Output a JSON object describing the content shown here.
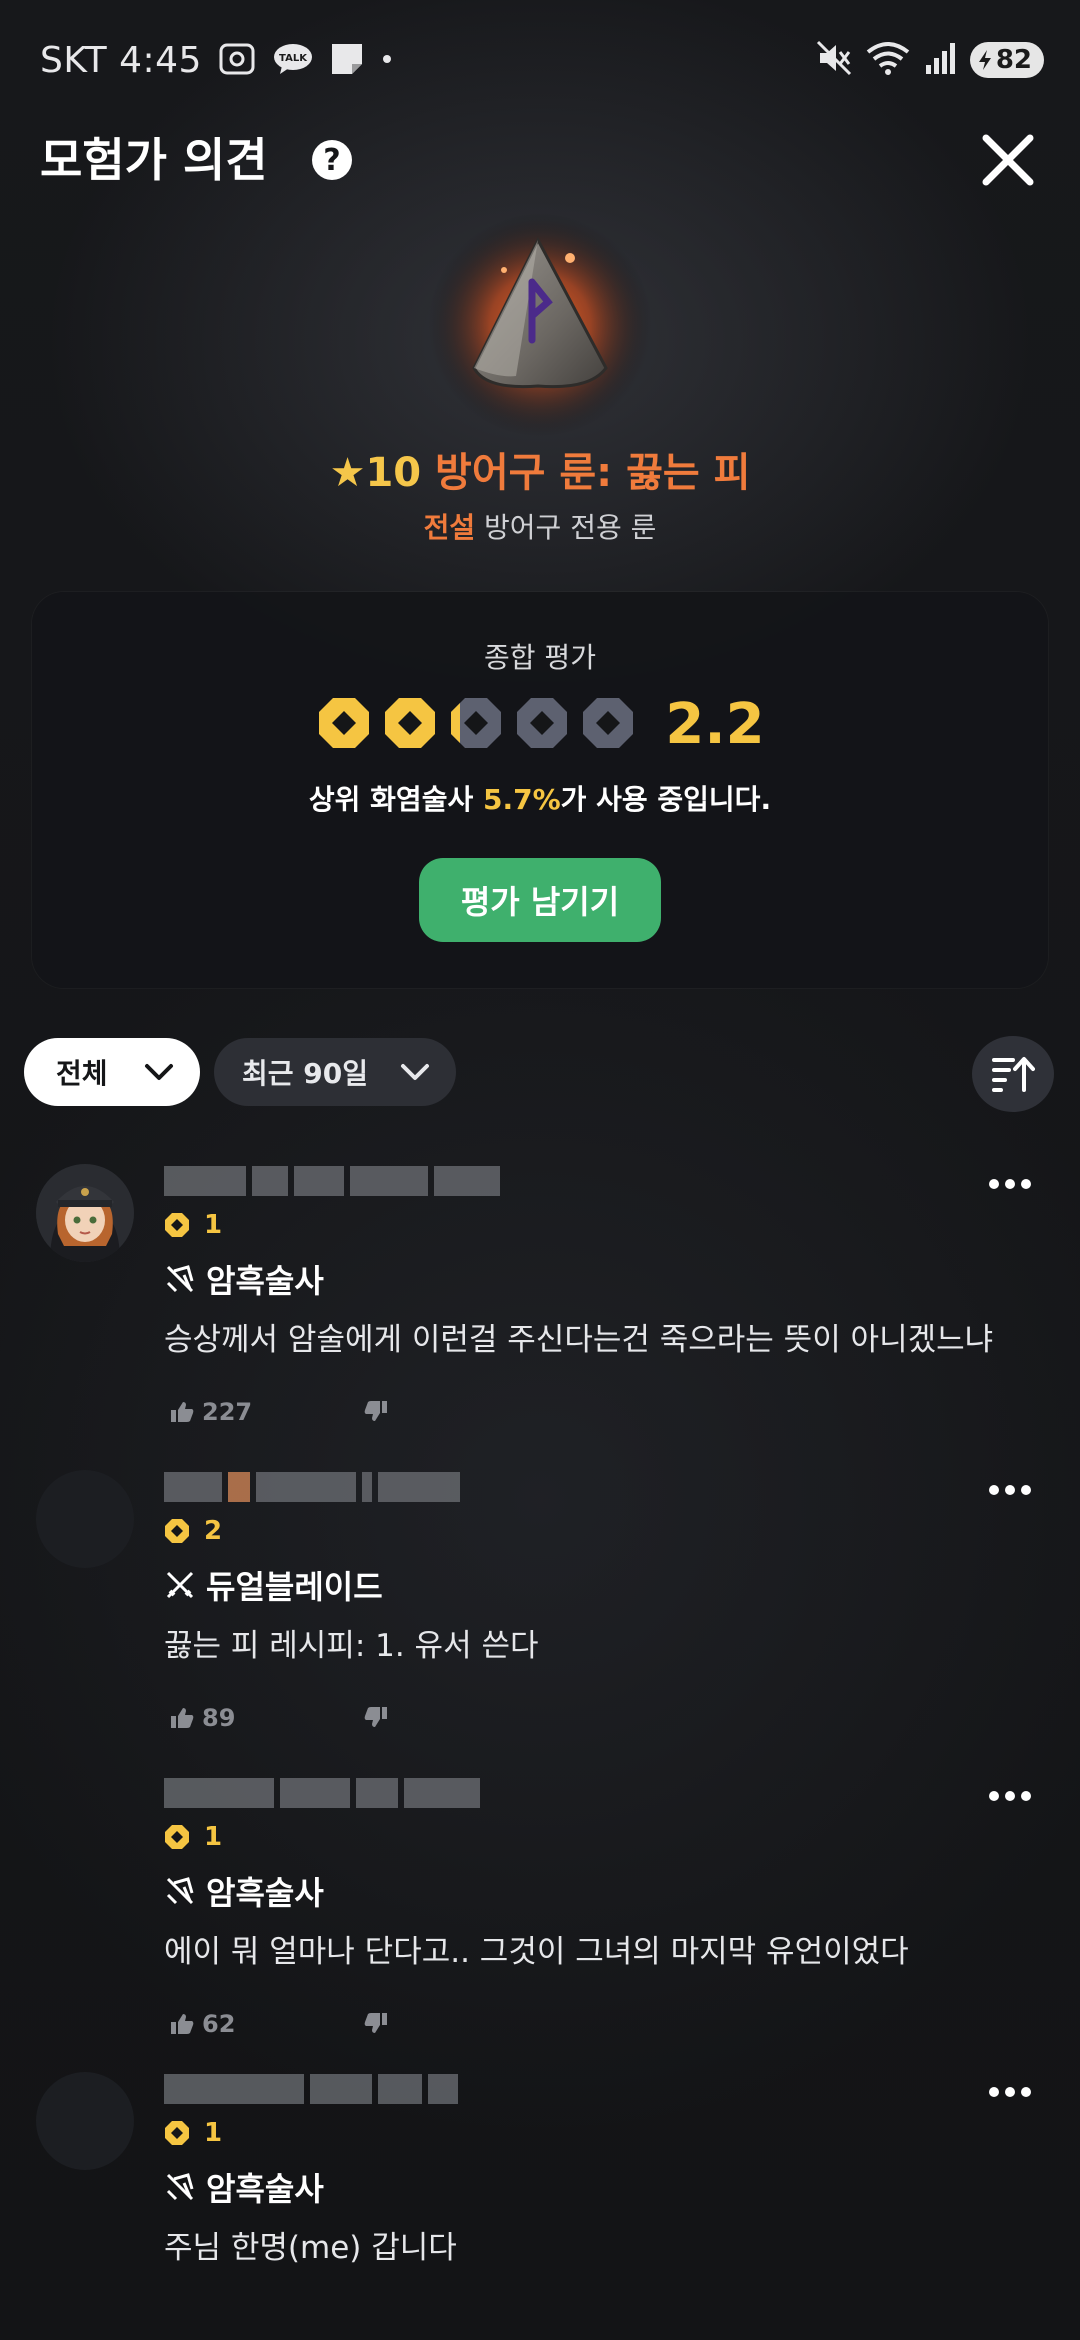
{
  "status_bar": {
    "carrier_time": "SKT 4:45",
    "battery": "82"
  },
  "header": {
    "title": "모험가 의견",
    "help_glyph": "?"
  },
  "item": {
    "star_level": "★10",
    "name": "방어구 룬: 끓는 피",
    "grade": "전설",
    "type": "방어구 전용 룬",
    "accent_color": "#f07b3c"
  },
  "rating": {
    "label": "종합 평가",
    "score": "2.2",
    "max": 5,
    "desc_prefix": "상위 화염술사 ",
    "desc_pct": "5.7%",
    "desc_suffix": "가 사용 중입니다.",
    "button_label": "평가 남기기",
    "button_color": "#3fb06d",
    "score_color": "#f5c542"
  },
  "filters": {
    "scope": "전체",
    "period": "최근 90일"
  },
  "comments": [
    {
      "level": "1",
      "class": "암흑술사",
      "text": "승상께서 암술에게 이런걸 주신다는건 죽으라는 뜻이 아니겠느냐",
      "likes": "227"
    },
    {
      "level": "2",
      "class": "듀얼블레이드",
      "text": "끓는 피 레시피: 1. 유서  쓴다",
      "likes": "89"
    },
    {
      "level": "1",
      "class": "암흑술사",
      "text": "에이 뭐 얼마나 단다고..  그것이 그녀의 마지막 유언이었다",
      "likes": "62"
    },
    {
      "level": "1",
      "class": "암흑술사",
      "text": "주님 한명(me) 갑니다",
      "likes": ""
    }
  ]
}
